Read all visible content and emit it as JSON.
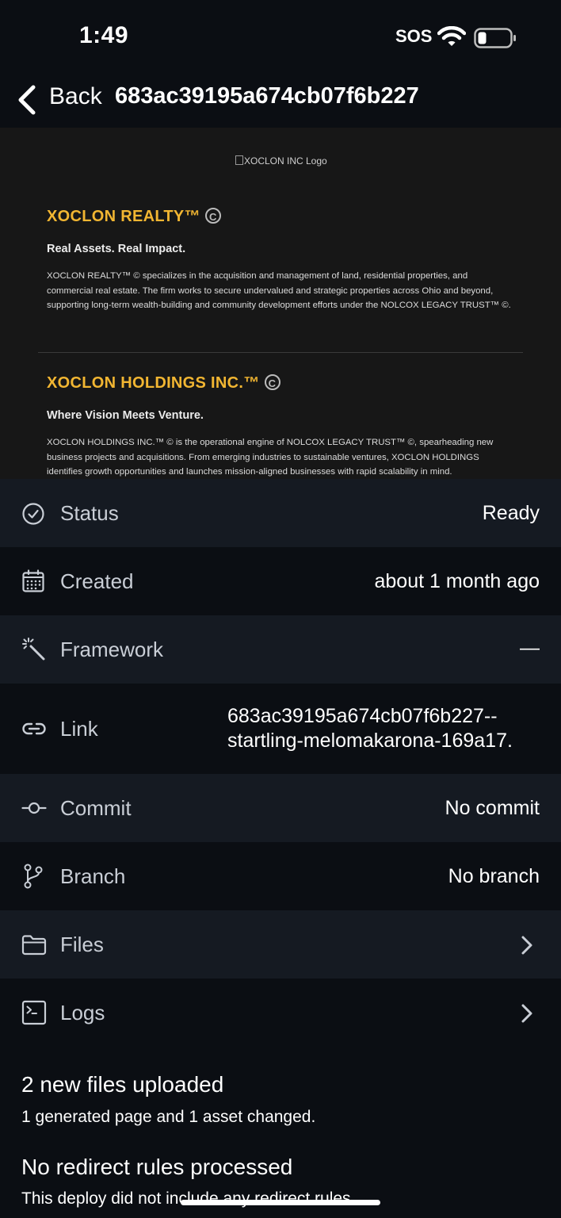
{
  "status_bar": {
    "time": "1:49",
    "sos": "SOS"
  },
  "nav": {
    "back_label": "Back",
    "title": "683ac39195a674cb07f6b227"
  },
  "preview": {
    "logo_alt": "XOCLON INC Logo",
    "sections": [
      {
        "heading": "XOCLON REALTY™",
        "subheading": "Real Assets. Real Impact.",
        "body": "XOCLON REALTY™ © specializes in the acquisition and management of land, residential properties, and commercial real estate. The firm works to secure undervalued and strategic properties across Ohio and beyond, supporting long-term wealth-building and community development efforts under the NOLCOX LEGACY TRUST™ ©."
      },
      {
        "heading": "XOCLON HOLDINGS INC.™",
        "subheading": "Where Vision Meets Venture.",
        "body": "XOCLON HOLDINGS INC.™ © is the operational engine of NOLCOX LEGACY TRUST™ ©, spearheading new business projects and acquisitions. From emerging industries to sustainable ventures, XOCLON HOLDINGS identifies growth opportunities and launches mission-aligned businesses with rapid scalability in mind."
      }
    ]
  },
  "details": {
    "status": {
      "label": "Status",
      "value": "Ready",
      "icon": "check-circle-icon"
    },
    "created": {
      "label": "Created",
      "value": "about 1 month ago",
      "icon": "calendar-icon"
    },
    "framework": {
      "label": "Framework",
      "value": "—",
      "icon": "magic-wand-icon"
    },
    "link": {
      "label": "Link",
      "value_line1": "683ac39195a674cb07f6b227--",
      "value_line2": "startling-melomakarona-169a17.",
      "icon": "link-icon"
    },
    "commit": {
      "label": "Commit",
      "value": "No commit",
      "icon": "git-commit-icon"
    },
    "branch": {
      "label": "Branch",
      "value": "No branch",
      "icon": "git-branch-icon"
    },
    "files": {
      "label": "Files",
      "icon": "folder-icon"
    },
    "logs": {
      "label": "Logs",
      "icon": "terminal-icon"
    }
  },
  "summary": {
    "files_title": "2 new files uploaded",
    "files_sub": "1 generated page and 1 asset changed.",
    "redirects_title": "No redirect rules processed",
    "redirects_sub": "This deploy did not include any redirect rules."
  },
  "colors": {
    "background": "#0b0e13",
    "row_alt": "#151a22",
    "preview_bg": "#171717",
    "brand_gold": "#f2b632",
    "label_gray": "#c9ced6"
  }
}
